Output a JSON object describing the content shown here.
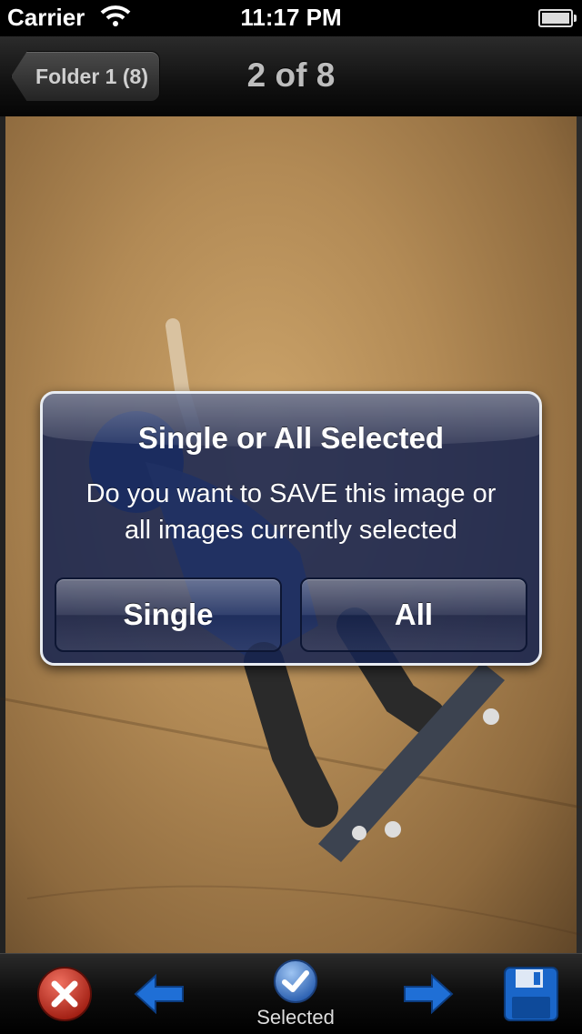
{
  "status_bar": {
    "carrier": "Carrier",
    "time": "11:17 PM"
  },
  "nav": {
    "back_label": "Folder 1 (8)",
    "title": "2 of 8"
  },
  "alert": {
    "title": "Single or All Selected",
    "message_line1": "Do you want to SAVE this image or",
    "message_line2": "all images currently selected",
    "buttons": [
      "Single",
      "All"
    ]
  },
  "toolbar": {
    "items": [
      {
        "icon": "close-icon"
      },
      {
        "icon": "arrow-left-icon"
      },
      {
        "icon": "checkmark-icon",
        "label": "Selected"
      },
      {
        "icon": "arrow-right-icon"
      },
      {
        "icon": "floppy-disk-icon"
      }
    ]
  },
  "colors": {
    "alert_background": "#162452",
    "toolbar_blue": "#1f6fd6",
    "cancel_red": "#c0392b"
  }
}
